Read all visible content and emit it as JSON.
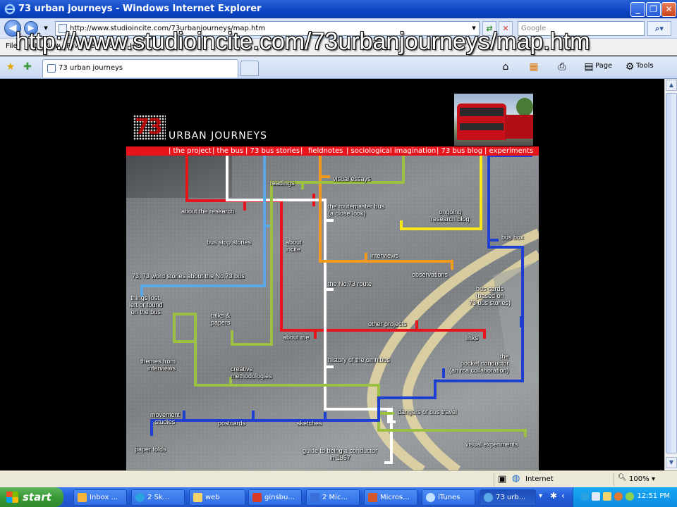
{
  "window": {
    "title": "73 urban journeys - Windows Internet Explorer"
  },
  "address": {
    "url": "http://www.studioincite.com/73urbanjourneys/map.htm",
    "search_placeholder": "Google"
  },
  "overlay_url": "http://www.studioincite.com/73urbanjourneys/map.htm",
  "menu": {
    "items": [
      "File",
      "Edit",
      "View",
      "Favorites",
      "Tools",
      "Help"
    ]
  },
  "tab": {
    "title": "73 urban journeys"
  },
  "commands": {
    "page": "Page",
    "tools": "Tools"
  },
  "site": {
    "logo_number": "73",
    "brand": "URBAN JOURNEYS",
    "nav": [
      "| the project",
      "| the bus",
      "| 73 bus stories",
      "|",
      "fieldnotes",
      "| sociological imagination",
      "| 73 bus blog",
      "| experiments"
    ]
  },
  "map_labels": {
    "readings": "readings",
    "visual_essays": "visual essays",
    "about_research": "about the research",
    "routemaster_1": "the routemaster bus",
    "routemaster_2": "(a close look)",
    "ongoing_1": "ongoing",
    "ongoing_2": "research blog",
    "bus_box": "bus box",
    "bus_stop_stories": "bus stop stories",
    "about_incite_1": "about",
    "about_incite_2": "incite",
    "interviews": "interviews",
    "observations": "observations",
    "word_stories": "73, 73 word stories about the No.73 bus",
    "no73_route": "the No.73 route",
    "bus_cards_1": "bus cards",
    "bus_cards_2": "(based on",
    "bus_cards_3": "73 bus stories)",
    "things_lost_1": "things lost,",
    "things_lost_2": "left or found",
    "things_lost_3": "on the bus",
    "talks_1": "talks &",
    "talks_2": "papers",
    "other_projects": "other projects",
    "about_me": "about me",
    "links": "links",
    "themes_1": "themes from",
    "themes_2": "interviews",
    "history": "history of the omnibus",
    "creative_1": "creative",
    "creative_2": "methodologies",
    "pocket_1": "the",
    "pocket_2": "pocket conductor",
    "pocket_3": "(an rca collaboration)",
    "dangers": "dangers of bus travel",
    "movement_1": "movement",
    "movement_2": "studies",
    "postcards": "postcards",
    "sketches": "sketches",
    "paper_folds": "paper folds",
    "guide_1": "guide to being a conductor",
    "guide_2": "in 1857",
    "visual_experiments": "visual experiments"
  },
  "colors": {
    "red": "#e8141c",
    "white": "#ffffff",
    "lightblue": "#5aa9e6",
    "orange": "#f39a1e",
    "green": "#9cc043",
    "yellow": "#f7e81c",
    "blue": "#1f3fd0",
    "taskbar": "#245edb"
  },
  "status": {
    "zone": "Internet",
    "zoom": "100%"
  },
  "taskbar": {
    "start": "start",
    "tasks": [
      "Inbox ...",
      "2 Sk...",
      "web",
      "ginsbu...",
      "2 Mic...",
      "Micros...",
      "iTunes",
      "73 urb..."
    ],
    "clock": "12:51 PM"
  }
}
